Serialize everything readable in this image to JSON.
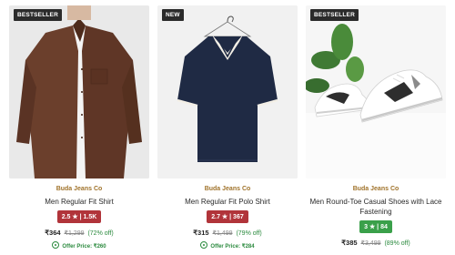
{
  "products": [
    {
      "badge": "BESTSELLER",
      "brand": "Buda Jeans Co",
      "title": "Men Regular Fit Shirt",
      "rating_text": "2.5 ★ | 1.5K",
      "rating_color": "#b1343a",
      "price": "₹364",
      "mrp": "₹1,299",
      "discount": "(72% off)",
      "offer": "Offer Price: ₹260"
    },
    {
      "badge": "NEW",
      "brand": "Buda Jeans Co",
      "title": "Men Regular Fit Polo Shirt",
      "rating_text": "2.7 ★ | 367",
      "rating_color": "#b1343a",
      "price": "₹315",
      "mrp": "₹1,499",
      "discount": "(79% off)",
      "offer": "Offer Price: ₹284"
    },
    {
      "badge": "BESTSELLER",
      "brand": "Buda Jeans Co",
      "title": "Men Round-Toe Casual Shoes with Lace Fastening",
      "rating_text": "3 ★ | 84",
      "rating_color": "#3aa04a",
      "price": "₹385",
      "mrp": "₹3,499",
      "discount": "(89% off)",
      "offer": ""
    }
  ]
}
